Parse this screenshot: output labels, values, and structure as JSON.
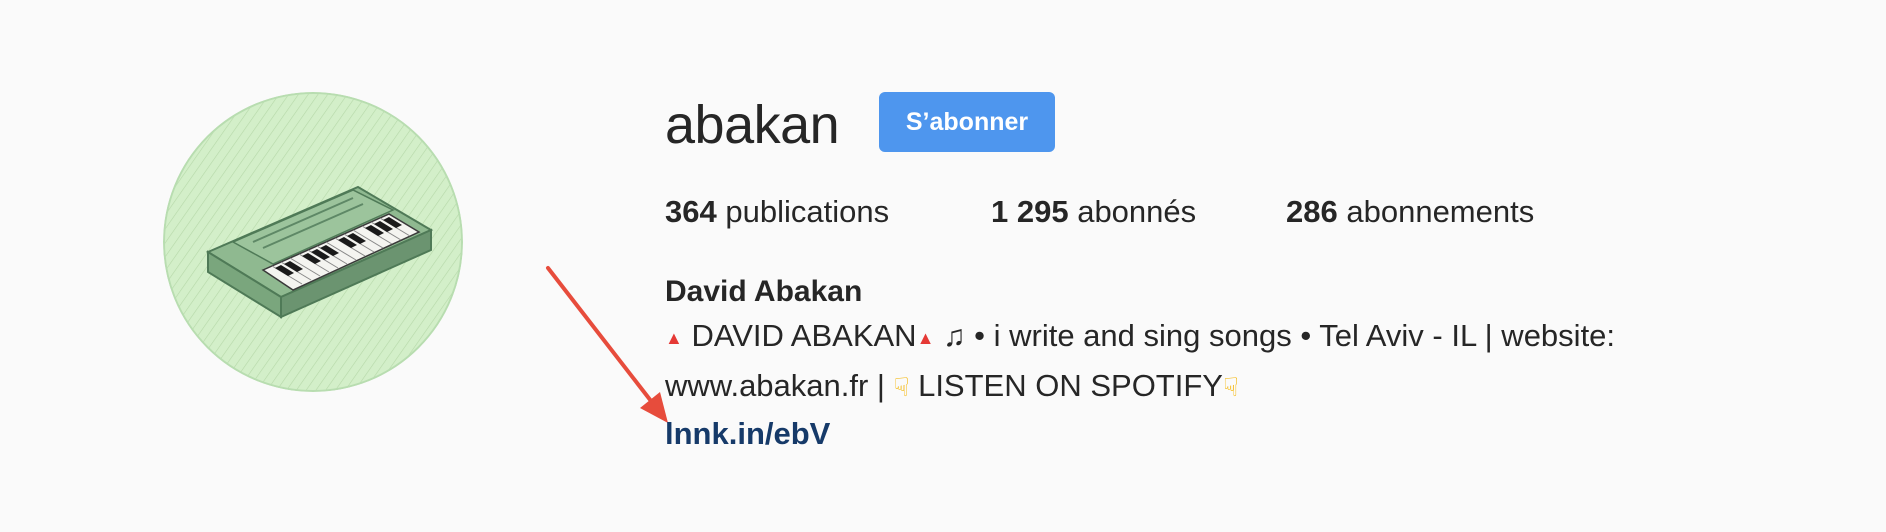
{
  "profile": {
    "username": "abakan",
    "follow_label": "S’abonner",
    "avatar_icon": "keyboard-piano-icon"
  },
  "stats": {
    "posts_count": "364",
    "posts_label": "publications",
    "followers_count": "1 295",
    "followers_label": "abonnés",
    "following_count": "286",
    "following_label": "abonnements"
  },
  "bio": {
    "name": "David Abakan",
    "line1_text_a": "DAVID ABAKAN",
    "line1_text_b": "• i write and sing songs • Tel Aviv - IL | website:",
    "line2_text_a": "www.abakan.fr |",
    "line2_text_b": "LISTEN ON SPOTIFY",
    "link": "lnnk.in/ebV"
  },
  "colors": {
    "button_bg": "#4e96ee",
    "link": "#163a69",
    "arrow": "#e74c3c",
    "avatar_bg": "#cfeec4"
  }
}
